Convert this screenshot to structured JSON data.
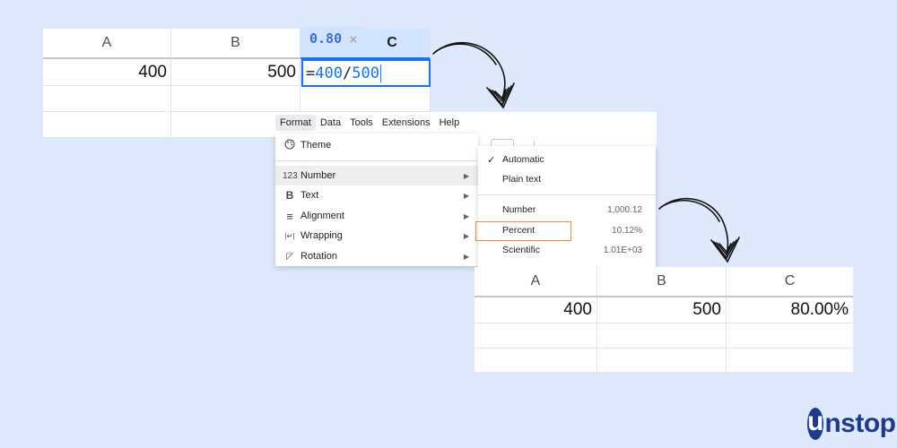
{
  "sheet1": {
    "headers": [
      "A",
      "B",
      "C"
    ],
    "row1": {
      "a": "400",
      "b": "500"
    },
    "formula": {
      "eq": "=",
      "ref1": "400",
      "slash": "/",
      "ref2": "500"
    },
    "tooltip": {
      "value": "0.80",
      "close": "×"
    }
  },
  "menubar": {
    "items": [
      "Format",
      "Data",
      "Tools",
      "Extensions",
      "Help"
    ]
  },
  "format_menu": {
    "items": [
      {
        "label": "Theme",
        "icon": "palette-icon",
        "glyph": "🎨"
      },
      {
        "label": "Number",
        "icon": "number-format-icon",
        "glyph": "123"
      },
      {
        "label": "Text",
        "icon": "bold-icon",
        "glyph": "B"
      },
      {
        "label": "Alignment",
        "icon": "align-icon",
        "glyph": "≡"
      },
      {
        "label": "Wrapping",
        "icon": "wrap-icon",
        "glyph": "|↵|"
      },
      {
        "label": "Rotation",
        "icon": "rotation-icon",
        "glyph": "◸"
      }
    ]
  },
  "number_menu": {
    "items": [
      {
        "label": "Automatic",
        "example": "",
        "checked": true
      },
      {
        "label": "Plain text",
        "example": ""
      },
      {
        "label": "Number",
        "example": "1,000.12"
      },
      {
        "label": "Percent",
        "example": "10.12%"
      },
      {
        "label": "Scientific",
        "example": "1.01E+03"
      }
    ],
    "highlight_color": "#e8893b"
  },
  "sheet2": {
    "headers": [
      "A",
      "B",
      "C"
    ],
    "row1": {
      "a": "400",
      "b": "500",
      "c": "80.00%"
    }
  },
  "brand": {
    "logo_first": "u",
    "logo_rest": "nstop",
    "color": "#1f3a8a"
  },
  "colors": {
    "background": "#deeafb",
    "accent": "#1a73e8"
  }
}
